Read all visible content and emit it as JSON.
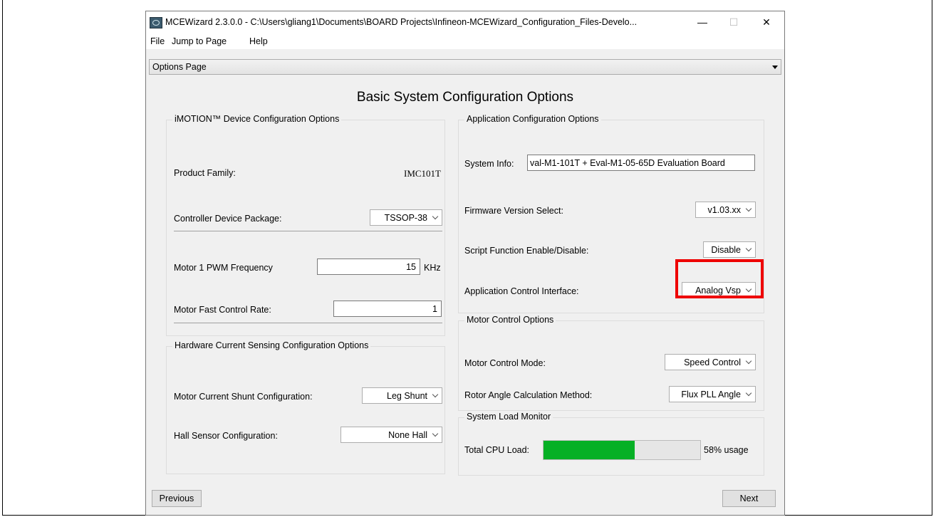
{
  "window": {
    "title": "MCEWizard 2.3.0.0  - C:\\Users\\gliang1\\Documents\\BOARD Projects\\Infineon-MCEWizard_Configuration_Files-Develo...",
    "minimize": "—",
    "maximize": "☐",
    "close": "✕"
  },
  "menu": [
    "File",
    "Jump to Page",
    "Help"
  ],
  "page_selector": {
    "value": "Options Page"
  },
  "heading": "Basic System Configuration Options",
  "device": {
    "title": "iMOTION™ Device Configuration Options",
    "product_family_label": "Product Family:",
    "product_family_value": "IMC101T",
    "package_label": "Controller Device Package:",
    "package_value": "TSSOP-38",
    "pwm_label": "Motor 1 PWM Frequency",
    "pwm_value": "15",
    "pwm_unit": "KHz",
    "fast_rate_label": "Motor Fast Control Rate:",
    "fast_rate_value": "1"
  },
  "hardware": {
    "title": "Hardware Current Sensing Configuration Options",
    "shunt_label": "Motor Current Shunt Configuration:",
    "shunt_value": "Leg Shunt",
    "hall_label": "Hall Sensor Configuration:",
    "hall_value": "None Hall"
  },
  "application": {
    "title": "Application Configuration Options",
    "system_info_label": "System Info:",
    "system_info_value": "val-M1-101T + Eval-M1-05-65D Evaluation Board",
    "firmware_label": "Firmware Version Select:",
    "firmware_value": "v1.03.xx",
    "script_label": "Script Function Enable/Disable:",
    "script_value": "Disable",
    "interface_label": "Application Control Interface:",
    "interface_value": "Analog Vsp",
    "highlight_color": "#ee0000"
  },
  "motor_control": {
    "title": "Motor Control Options",
    "mode_label": "Motor Control Mode:",
    "mode_value": "Speed Control",
    "angle_label": "Rotor Angle Calculation Method:",
    "angle_value": "Flux PLL Angle"
  },
  "load": {
    "title": "System Load Monitor",
    "cpu_label": "Total CPU Load:",
    "cpu_percent": 58,
    "cpu_text": "58% usage",
    "bar_color": "#06b025"
  },
  "nav": {
    "previous": "Previous",
    "next": "Next"
  }
}
